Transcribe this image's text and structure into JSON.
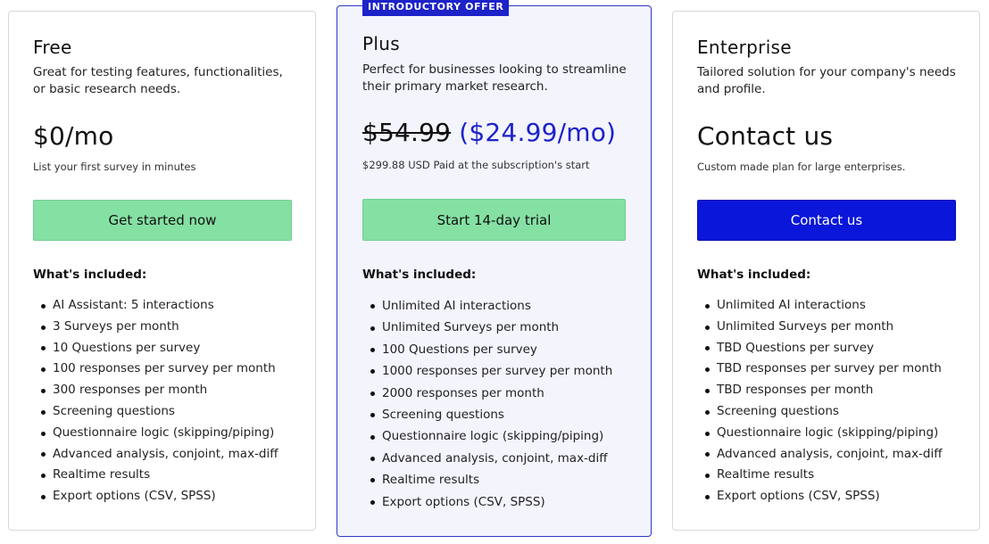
{
  "plans": {
    "free": {
      "name": "Free",
      "description": "Great for testing features, functionalities, or basic research needs.",
      "price": "$0/mo",
      "note": "List your first survey in minutes",
      "cta": "Get started now",
      "included_title": "What's included:",
      "features": [
        "AI Assistant: 5 interactions",
        "3 Surveys per month",
        "10 Questions per survey",
        "100 responses per survey per month",
        "300 responses per month",
        "Screening questions",
        "Questionnaire logic (skipping/piping)",
        "Advanced analysis, conjoint, max-diff",
        "Realtime results",
        "Export options (CSV, SPSS)"
      ]
    },
    "plus": {
      "badge": "INTRODUCTORY OFFER",
      "name": "Plus",
      "description": "Perfect for businesses looking to streamline their primary market research.",
      "old_price": "$54.99",
      "new_price": "($24.99/mo)",
      "note": "$299.88 USD Paid at the subscription's start",
      "cta": "Start 14-day trial",
      "included_title": "What's included:",
      "features": [
        "Unlimited AI interactions",
        "Unlimited Surveys per month",
        "100 Questions per survey",
        "1000 responses per survey per month",
        "2000 responses per month",
        "Screening questions",
        "Questionnaire logic (skipping/piping)",
        "Advanced analysis, conjoint, max-diff",
        "Realtime results",
        "Export options (CSV, SPSS)"
      ]
    },
    "enterprise": {
      "name": "Enterprise",
      "description": "Tailored solution for your company's needs and profile.",
      "price": "Contact us",
      "note": "Custom made plan for large enterprises.",
      "cta": "Contact us",
      "included_title": "What's included:",
      "features": [
        "Unlimited AI interactions",
        "Unlimited Surveys per month",
        "TBD Questions per survey",
        "TBD responses per survey per month",
        "TBD responses per month",
        "Screening questions",
        "Questionnaire logic (skipping/piping)",
        "Advanced analysis, conjoint, max-diff",
        "Realtime results",
        "Export options (CSV, SPSS)"
      ]
    }
  },
  "colors": {
    "accent_blue": "#1d22c9",
    "cta_green": "#85e0a3",
    "cta_blue": "#0a16d9"
  }
}
